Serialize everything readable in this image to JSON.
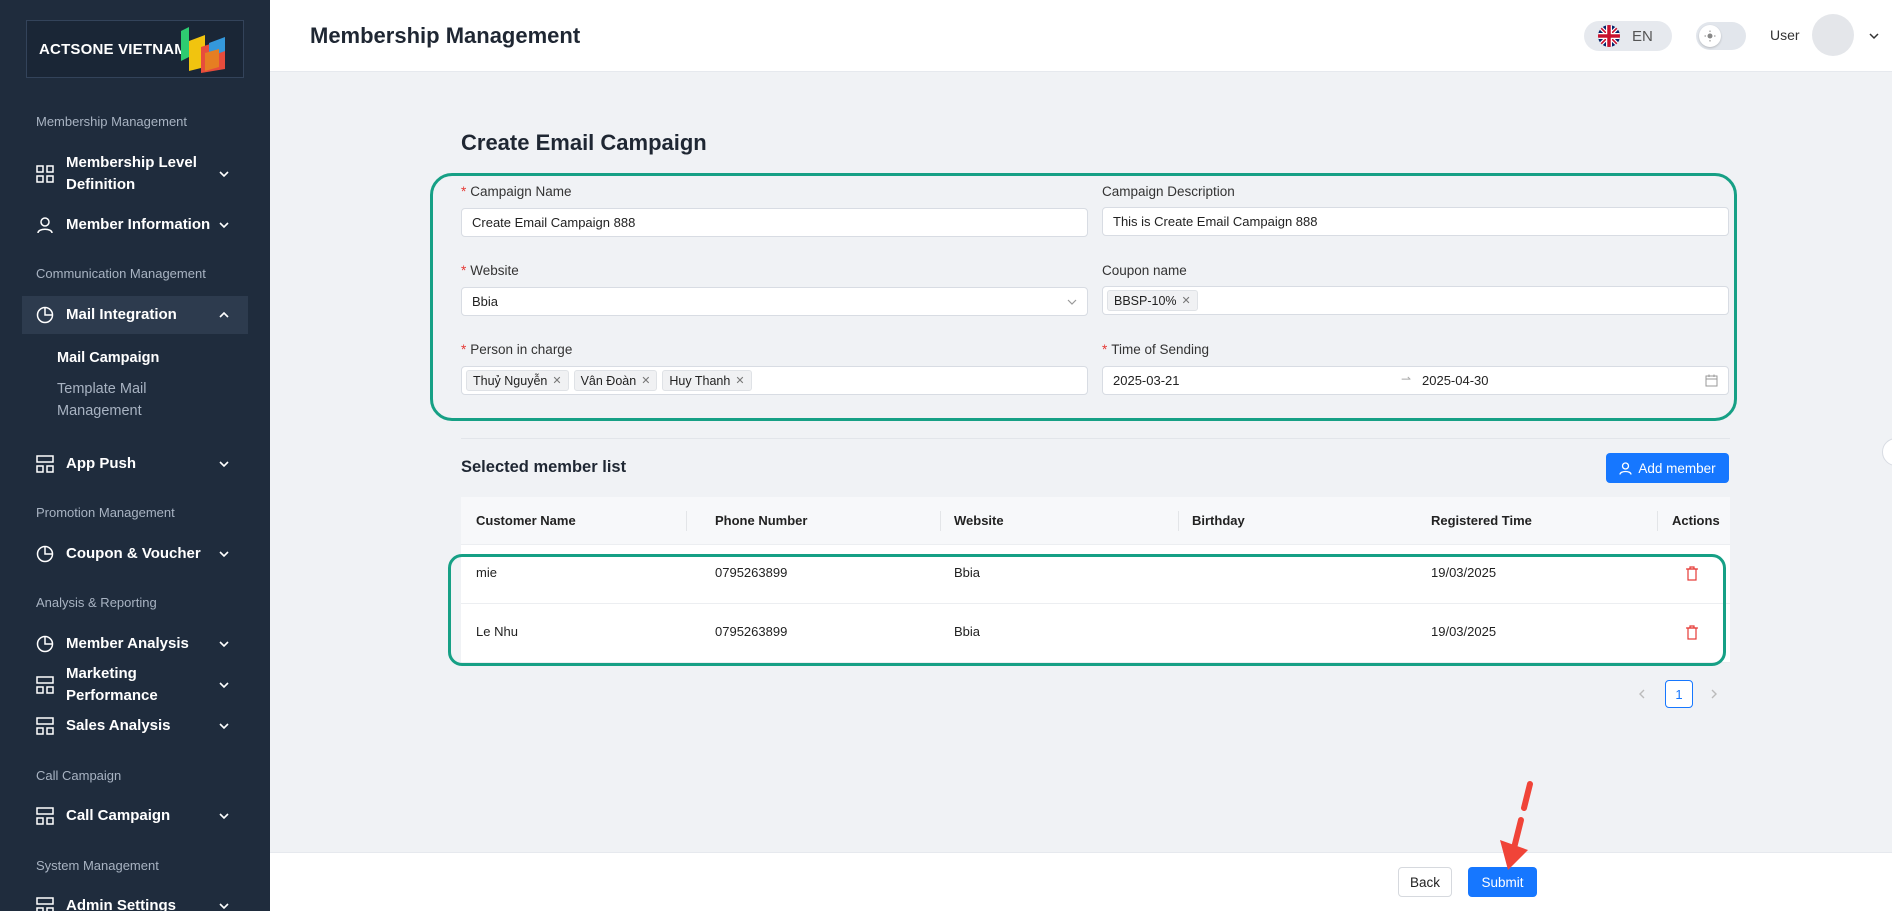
{
  "brand": {
    "name": "ACTSONE VIETNAM"
  },
  "sidebar": {
    "sections": [
      "Membership Management",
      "Communication Management",
      "Promotion Management",
      "Analysis & Reporting",
      "Call Campaign",
      "System Management"
    ],
    "items": {
      "membership_level": {
        "label": "Membership Level Definition",
        "icon": "grid-icon"
      },
      "member_information": {
        "label": "Member Information",
        "icon": "user-icon"
      },
      "mail_integration": {
        "label": "Mail Integration",
        "icon": "pie-chart-icon"
      },
      "app_push": {
        "label": "App Push",
        "icon": "layout-icon"
      },
      "coupon_voucher": {
        "label": "Coupon & Voucher",
        "icon": "pie-chart-icon"
      },
      "member_analysis": {
        "label": "Member Analysis",
        "icon": "pie-chart-icon"
      },
      "marketing_performance": {
        "label": "Marketing Performance",
        "icon": "layout-icon"
      },
      "sales_analysis": {
        "label": "Sales Analysis",
        "icon": "layout-icon"
      },
      "call_campaign": {
        "label": "Call Campaign",
        "icon": "layout-icon"
      },
      "admin_settings": {
        "label": "Admin Settings",
        "icon": "layout-icon"
      }
    },
    "sub_items": {
      "mail_campaign": "Mail Campaign",
      "template_mail": "Template Mail Management"
    }
  },
  "header": {
    "title": "Membership Management",
    "language": "EN",
    "user_label": "User"
  },
  "form": {
    "title": "Create Email Campaign",
    "campaign_name": {
      "label": "Campaign Name",
      "value": "Create Email Campaign 888"
    },
    "campaign_description": {
      "label": "Campaign Description",
      "value": "This is Create Email Campaign 888"
    },
    "website": {
      "label": "Website",
      "value": "Bbia"
    },
    "coupon_name": {
      "label": "Coupon name",
      "tags": [
        "BBSP-10%"
      ]
    },
    "person_in_charge": {
      "label": "Person in charge",
      "tags": [
        "Thuỷ Nguyễn",
        "Vân Đoàn",
        "Huy Thanh"
      ]
    },
    "time_of_sending": {
      "label": "Time of Sending",
      "start": "2025-03-21",
      "end": "2025-04-30"
    }
  },
  "member_list": {
    "title": "Selected member list",
    "add_button": "Add member",
    "columns": [
      "Customer Name",
      "Phone Number",
      "Website",
      "Birthday",
      "Registered Time",
      "Actions"
    ],
    "rows": [
      {
        "name": "mie",
        "phone": "0795263899",
        "website": "Bbia",
        "birthday": "",
        "registered": "19/03/2025"
      },
      {
        "name": "Le Nhu",
        "phone": "0795263899",
        "website": "Bbia",
        "birthday": "",
        "registered": "19/03/2025"
      }
    ],
    "current_page": "1"
  },
  "footer": {
    "back_label": "Back",
    "submit_label": "Submit"
  },
  "colors": {
    "sidebar_bg": "#1f2c3d",
    "primary": "#1677ff",
    "highlight": "#16a085",
    "annotation_arrow": "#f04438",
    "danger": "#e53935"
  }
}
